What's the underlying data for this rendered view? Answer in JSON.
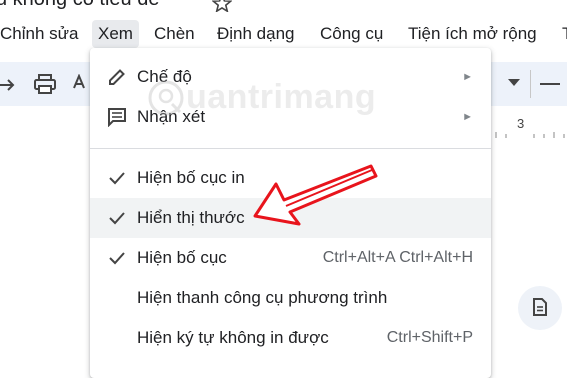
{
  "title": {
    "text": "u không có tiêu đề"
  },
  "menubar": {
    "items": [
      "Chỉnh sửa",
      "Xem",
      "Chèn",
      "Định dạng",
      "Công cụ",
      "Tiện ích mở rộng",
      "T"
    ],
    "active": "Xem"
  },
  "ruler": {
    "mark": "3"
  },
  "dropdown": {
    "items": [
      {
        "label": "Chế độ",
        "icon": "pencil-icon",
        "submenu": true
      },
      {
        "label": "Nhận xét",
        "icon": "comment-icon",
        "submenu": true
      },
      {
        "label": "Hiện bố cục in",
        "checked": true
      },
      {
        "label": "Hiển thị thước",
        "checked": true,
        "highlighted": true
      },
      {
        "label": "Hiện bố cục",
        "checked": true,
        "shortcut": "Ctrl+Alt+A Ctrl+Alt+H"
      },
      {
        "label": "Hiện thanh công cụ phương trình",
        "checked": false
      },
      {
        "label": "Hiện ký tự không in được",
        "checked": false,
        "shortcut": "Ctrl+Shift+P"
      }
    ]
  },
  "watermark": {
    "text": "uantrimang"
  },
  "colors": {
    "toolbar_bg": "#edf2fa",
    "menu_active": "#e8eaed",
    "arrow": "#e8141c",
    "hover": "#f1f3f4"
  }
}
